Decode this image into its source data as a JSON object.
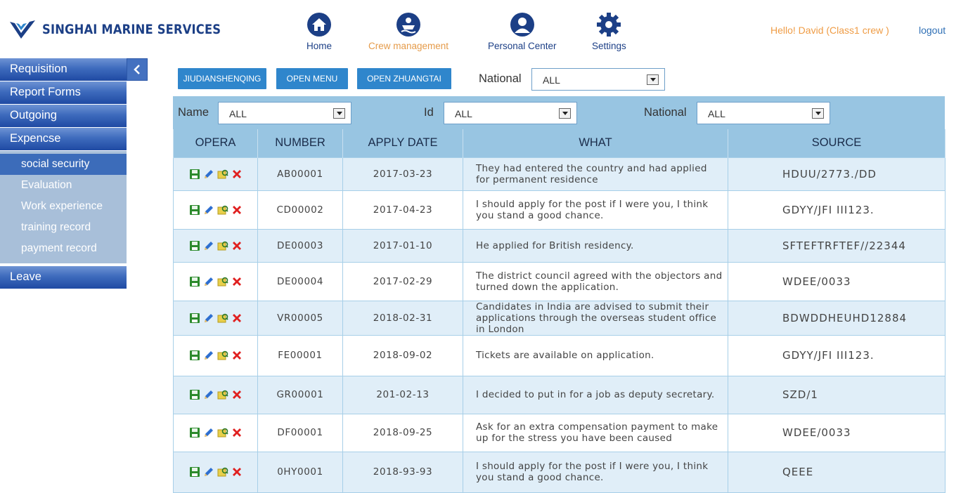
{
  "header": {
    "brand": "SINGHAI MARINE SERVICES",
    "nav": [
      {
        "label": "Home",
        "icon": "home-icon"
      },
      {
        "label": "Crew management",
        "icon": "crew-icon"
      },
      {
        "label": "Personal Center",
        "icon": "user-icon"
      },
      {
        "label": "Settings",
        "icon": "gear-icon"
      }
    ],
    "active_nav": "Crew management",
    "greeting": "Hello!  David (Class1 crew )",
    "logout": "logout"
  },
  "sidebar": {
    "items": [
      {
        "label": "Requisition"
      },
      {
        "label": "Report Forms"
      },
      {
        "label": "Outgoing"
      },
      {
        "label": "Expencse"
      }
    ],
    "subitems": [
      {
        "label": "social security"
      },
      {
        "label": "Evaluation"
      },
      {
        "label": "Work experience"
      },
      {
        "label": "training record"
      },
      {
        "label": "payment record"
      }
    ],
    "active_subitem": "social security",
    "after_items": [
      {
        "label": "Leave"
      }
    ],
    "collapse_icon": "chevron-left-icon"
  },
  "toolbar": {
    "buttons": [
      "JIUDIANSHENQING",
      "OPEN MENU",
      "OPEN ZHUANGTAI"
    ],
    "national_label": "National",
    "national_value": "ALL"
  },
  "filters": {
    "name_label": "Name",
    "name_value": "ALL",
    "id_label": "Id",
    "id_value": "ALL",
    "national_label": "National",
    "national_value": "ALL"
  },
  "table": {
    "columns": [
      "OPERA",
      "NUMBER",
      "APPLY DATE",
      "WHAT",
      "SOURCE"
    ],
    "op_icons": [
      "save-icon",
      "edit-icon",
      "view-icon",
      "delete-icon"
    ],
    "rows": [
      {
        "number": "AB00001",
        "date": "2017-03-23",
        "what": "They had entered the country and had applied for permanent residence",
        "source": "HDUU/2773./DD"
      },
      {
        "number": "CD00002",
        "date": "2017-04-23",
        "what": "I should apply for the post if I were you, I think you stand a good chance.",
        "source": "GDYY/JFI III123."
      },
      {
        "number": "DE00003",
        "date": "2017-01-10",
        "what": "He applied for British residency.",
        "source": "SFTEFTRFTEF//22344"
      },
      {
        "number": "DE00004",
        "date": "2017-02-29",
        "what": "The district council agreed with the objectors and turned down the application.",
        "source": "WDEE/0033"
      },
      {
        "number": "VR00005",
        "date": "2018-02-31",
        "what": "Candidates in India are advised to submit their applications through the overseas student office in London",
        "source": "BDWDDHEUHD12884"
      },
      {
        "number": "FE00001",
        "date": "2018-09-02",
        "what": "Tickets are available on application.",
        "source": "GDYY/JFI III123."
      },
      {
        "number": "GR00001",
        "date": "201-02-13",
        "what": "I decided to put in for a job as deputy secretary.",
        "source": "SZD/1"
      },
      {
        "number": "DF00001",
        "date": "2018-09-25",
        "what": "Ask for an extra compensation payment to make up for the stress you have been caused",
        "source": "WDEE/0033"
      },
      {
        "number": "0HY0001",
        "date": "2018-93-93",
        "what": "I should apply for the post if I were you, I think you stand a good chance.",
        "source": "QEEE"
      }
    ]
  },
  "colors": {
    "brand": "#1c3f86",
    "accent_orange": "#ef9c45",
    "button_blue": "#2f86cc",
    "table_header": "#98c5e2",
    "row_alt": "#e0eef8"
  }
}
